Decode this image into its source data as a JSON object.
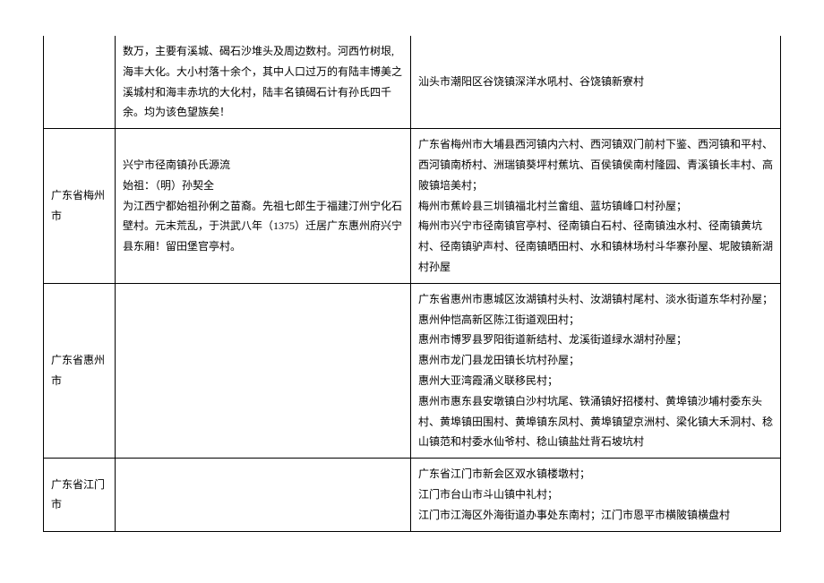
{
  "rows": [
    {
      "city": "",
      "origin": "数万，主要有溪城、碣石沙堆头及周边数村。河西竹树垠,海丰大化。大小村落十余个，其中人口过万的有陆丰博美之溪城村和海丰赤坑的大化村，陆丰名镇碣石计有孙氏四千余。均为该色望族矣！",
      "villages": "汕头市潮阳区谷饶镇深洋水吼村、谷饶镇新寮村"
    },
    {
      "city": "广东省梅州市",
      "origin": "兴宁市径南镇孙氏源流\n始祖：（明）孙契全\n为江西宁都始祖孙俐之苗裔。先祖七郎生于福建汀州宁化石壁村。元末荒乱，于洪武八年（1375）迁居广东惠州府兴宁县东厢！留田堡官亭村。",
      "villages": "广东省梅州市大埔县西河镇内六村、西河镇双门前村下鉴、西河镇和平村、西河镇南桥村、洲瑞镇葵坪村蕉坑、百侯镇侯南村隆园、青溪镇长丰村、高陂镇培美村；\n梅州市蕉岭县三圳镇福北村兰畲组、蓝坊镇峰口村孙屋；\n梅州市兴宁市径南镇官亭村、径南镇白石村、径南镇浊水村、径南镇黄坑村、径南镇驴声村、径南镇晒田村、水和镇林场村斗华寨孙屋、坭陂镇新湖村孙屋"
    },
    {
      "city": "广东省惠州市",
      "origin": "",
      "villages": "广东省惠州市惠城区汝湖镇村头村、汝湖镇村尾村、淡水街道东华村孙屋；\n惠州仲恺高新区陈江街道观田村；\n惠州市博罗县罗阳街道新结村、龙溪街道绿水湖村孙屋；\n惠州市龙门县龙田镇长坑村孙屋；\n惠州大亚湾霞涌义联移民村；\n惠州市惠东县安墩镇白沙村坑尾、铁涌镇好招楼村、黄埠镇沙埔村委东头村、黄埠镇田围村、黄埠镇东凤村、黄埠镇望京洲村、梁化镇大禾洞村、稔山镇范和村委水仙爷村、稔山镇盐灶背石坡坑村"
    },
    {
      "city": "广东省江门市",
      "origin": "",
      "villages": "广东省江门市新会区双水镇楼墩村；\n江门市台山市斗山镇中礼村；\n江门市江海区外海街道办事处东南村；江门市恩平市横陂镇横盘村"
    }
  ]
}
